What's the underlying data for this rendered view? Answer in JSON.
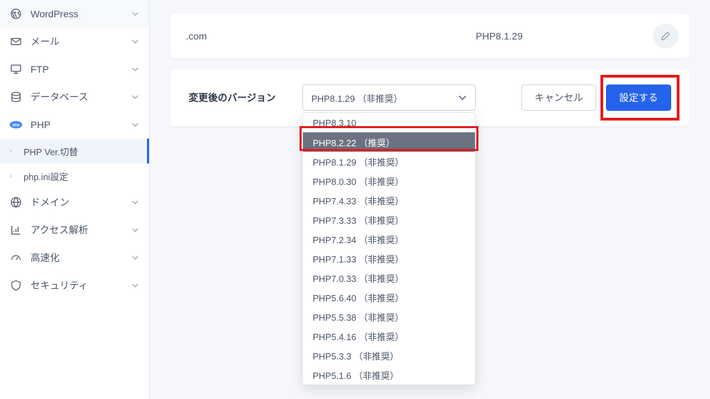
{
  "sidebar": {
    "items": [
      {
        "label": "WordPress",
        "icon": "wordpress"
      },
      {
        "label": "メール",
        "icon": "mail"
      },
      {
        "label": "FTP",
        "icon": "monitor"
      },
      {
        "label": "データベース",
        "icon": "database"
      },
      {
        "label": "PHP",
        "icon": "php",
        "expanded": true
      },
      {
        "label": "ドメイン",
        "icon": "globe"
      },
      {
        "label": "アクセス解析",
        "icon": "chart"
      },
      {
        "label": "高速化",
        "icon": "gauge"
      },
      {
        "label": "セキュリティ",
        "icon": "shield"
      }
    ],
    "php_subs": [
      {
        "label": "PHP Ver.切替",
        "active": true
      },
      {
        "label": "php.ini設定",
        "active": false
      }
    ]
  },
  "header": {
    "domain": ".com",
    "version": "PHP8.1.29"
  },
  "form": {
    "label": "変更後のバージョン",
    "selected_display": "PHP8.1.29 （非推奨）",
    "options": [
      "PHP8.3.10",
      "PHP8.2.22 （推奨）",
      "PHP8.1.29 （非推奨）",
      "PHP8.0.30 （非推奨）",
      "PHP7.4.33 （非推奨）",
      "PHP7.3.33 （非推奨）",
      "PHP7.2.34 （非推奨）",
      "PHP7.1.33 （非推奨）",
      "PHP7.0.33 （非推奨）",
      "PHP5.6.40 （非推奨）",
      "PHP5.5.38 （非推奨）",
      "PHP5.4.16 （非推奨）",
      "PHP5.3.3 （非推奨）",
      "PHP5.1.6 （非推奨）"
    ],
    "highlighted_option_index": 1,
    "cancel_label": "キャンセル",
    "submit_label": "設定する"
  }
}
